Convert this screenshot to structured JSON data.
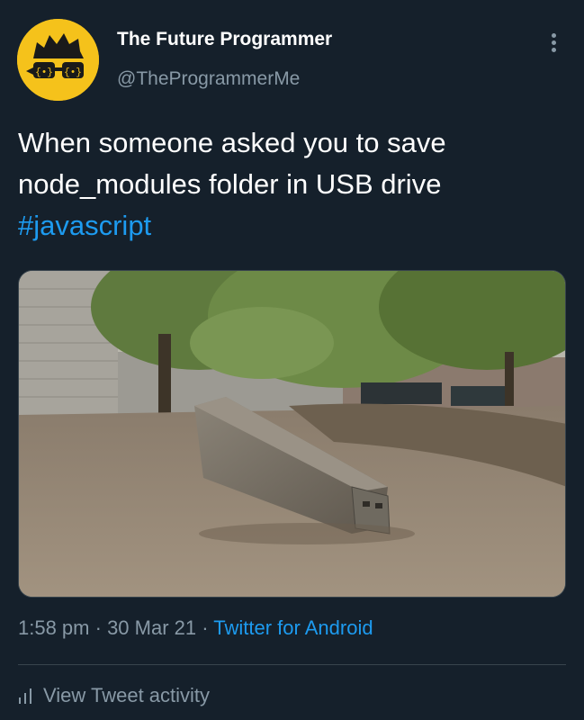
{
  "author": {
    "name": "The Future Programmer",
    "handle": "@TheProgrammerMe"
  },
  "tweet": {
    "line1": "When someone asked you to save",
    "line2": "node_modules folder in USB drive",
    "hashtag": "#javascript"
  },
  "meta": {
    "time": "1:58 pm",
    "separator1": " · ",
    "date": "30 Mar 21",
    "separator2": " · ",
    "source": "Twitter for Android"
  },
  "activity": {
    "label": "View Tweet activity"
  },
  "colors": {
    "background": "#15202b",
    "link": "#1d9bf0",
    "secondary_text": "#8899a6",
    "avatar_yellow": "#f5c21b"
  },
  "icons": {
    "more": "more-vertical-icon",
    "activity": "bar-chart-icon"
  }
}
